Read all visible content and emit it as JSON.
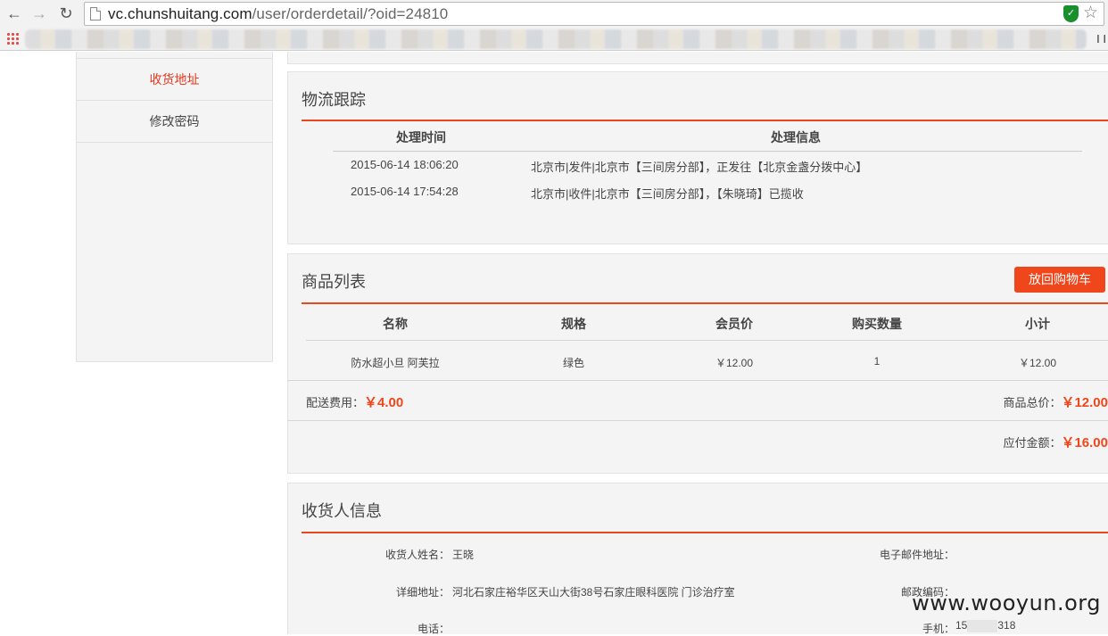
{
  "browser": {
    "url_host": "vc.chunshuitang.com",
    "url_path": "/user/orderdetail/?oid=24810",
    "bookmark_tail": "I I"
  },
  "sidebar": {
    "items": [
      {
        "label": "收货地址",
        "active": true
      },
      {
        "label": "修改密码",
        "active": false
      }
    ]
  },
  "logistics": {
    "title": "物流跟踪",
    "headers": [
      "处理时间",
      "处理信息"
    ],
    "rows": [
      {
        "time": "2015-06-14 18:06:20",
        "info": "北京市|发件|北京市【三间房分部】，正发往【北京金盏分拨中心】"
      },
      {
        "time": "2015-06-14 17:54:28",
        "info": "北京市|收件|北京市【三间房分部】，【朱晓琦】已揽收"
      }
    ]
  },
  "goods": {
    "title": "商品列表",
    "cart_button": "放回购物车",
    "headers": [
      "名称",
      "规格",
      "会员价",
      "购买数量",
      "小计"
    ],
    "rows": [
      {
        "name": "防水超小旦 阿芙拉",
        "spec": "绿色",
        "price": "￥12.00",
        "qty": "1",
        "subtotal": "￥12.00"
      }
    ],
    "shipping_label": "配送费用：",
    "shipping_value": "￥4.00",
    "total_label": "商品总价：",
    "total_value": "￥12.00",
    "payable_label": "应付金额：",
    "payable_value": "￥16.00"
  },
  "receiver": {
    "title": "收货人信息",
    "name_label": "收货人姓名：",
    "name_value": "王晓",
    "email_label": "电子邮件地址：",
    "address_label": "详细地址：",
    "address_value": "河北石家庄裕华区天山大街38号石家庄眼科医院 门诊治疗室",
    "zip_label": "邮政编码：",
    "phone_label": "电话：",
    "mobile_label": "手机：",
    "mobile_prefix": "15",
    "mobile_suffix": "318"
  },
  "watermark": "www.wooyun.org",
  "colors": {
    "accent": "#f0461b",
    "active_link": "#e8381e",
    "shield": "#1a8f2e"
  }
}
